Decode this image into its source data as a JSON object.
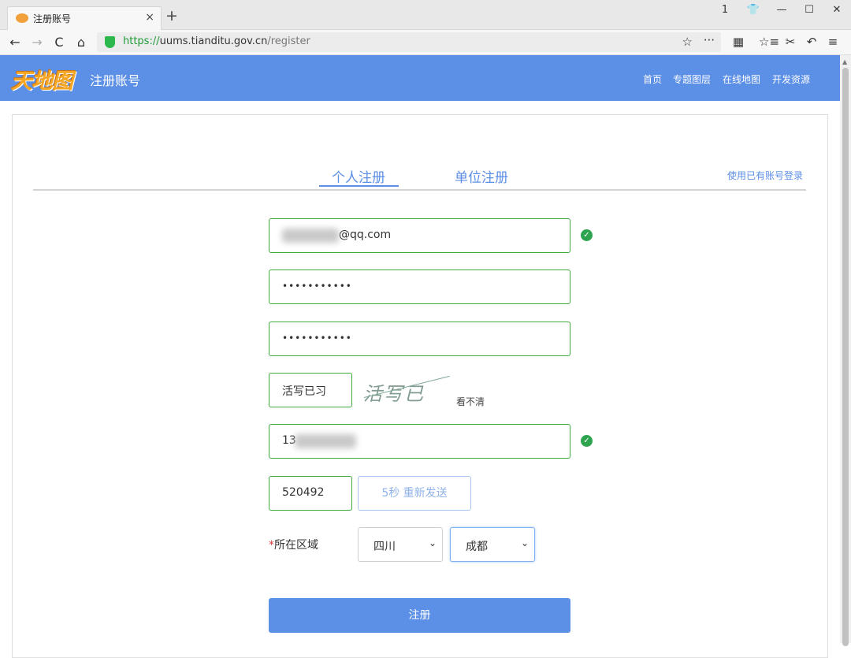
{
  "browser": {
    "tab_title": "注册账号",
    "tab_close": "×",
    "new_tab": "+",
    "url_scheme": "https://",
    "url_host": "uums.tianditu.gov.cn",
    "url_path": "/register",
    "window_controls": [
      "1",
      "👕",
      "—",
      "☐",
      "✕"
    ],
    "nav_icons": [
      "←",
      "→",
      "C",
      "⌂"
    ],
    "toolbar_icons": [
      "▦",
      "☆≡",
      "✂",
      "↶",
      "≡"
    ],
    "url_star": "☆",
    "url_more": "···"
  },
  "header": {
    "logo": "天地图",
    "title": "注册账号",
    "nav": [
      "首页",
      "专题图层",
      "在线地图",
      "开发资源"
    ],
    "accent": "#5c8fe6"
  },
  "tabs": {
    "personal": "个人注册",
    "unit": "单位注册",
    "login_link": "使用已有账号登录"
  },
  "form": {
    "email_suffix": "@qq.com",
    "password": "•••••••••••",
    "confirm_password": "•••••••••••",
    "captcha_input": "活写已习",
    "captcha_image_text": "活写已",
    "captcha_refresh": "看不清",
    "phone_prefix": "13",
    "sms_code": "520492",
    "resend_label": "5秒 重新发送",
    "region_required": "*",
    "region_label": "所在区域",
    "province": "四川",
    "city": "成都",
    "submit_label": "注册",
    "valid_icon": "✓",
    "valid_color": "#2ea44f"
  }
}
